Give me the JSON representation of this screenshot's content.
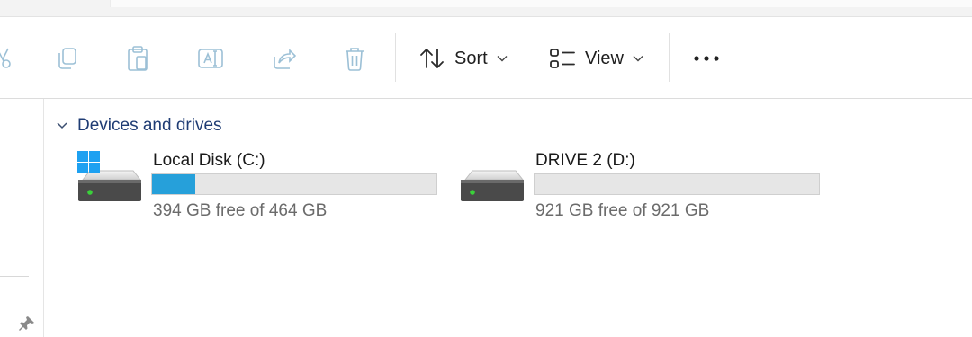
{
  "toolbar": {
    "buttons": [
      {
        "name": "cut",
        "icon": "cut-icon",
        "enabled": false
      },
      {
        "name": "copy",
        "icon": "copy-icon",
        "enabled": false
      },
      {
        "name": "paste",
        "icon": "paste-icon",
        "enabled": false
      },
      {
        "name": "rename",
        "icon": "rename-icon",
        "enabled": false
      },
      {
        "name": "share",
        "icon": "share-icon",
        "enabled": false
      },
      {
        "name": "delete",
        "icon": "trash-icon",
        "enabled": false
      }
    ],
    "sort_label": "Sort",
    "view_label": "View",
    "more_icon": "more-icon"
  },
  "group": {
    "title": "Devices and drives",
    "expanded": true
  },
  "drives": [
    {
      "name": "Local Disk (C:)",
      "free_text": "394 GB free of 464 GB",
      "used_fraction": 0.151,
      "icon": "windows-drive-icon"
    },
    {
      "name": "DRIVE 2 (D:)",
      "free_text": "921 GB free of 921 GB",
      "used_fraction": 0.0,
      "icon": "drive-icon"
    }
  ],
  "colors": {
    "accent": "#26a0da",
    "group_title": "#1f3c74",
    "disabled_icon": "#9cc0d6"
  }
}
